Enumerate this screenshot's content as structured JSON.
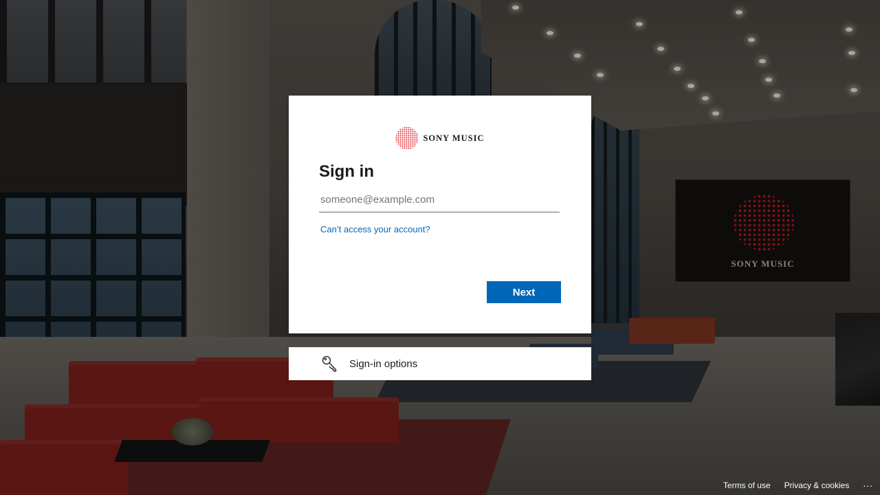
{
  "brand": {
    "logo_text": "SONY MUSIC",
    "logo_dot_color": "#e31b23",
    "tv_logo_text": "SONY MUSIC"
  },
  "signin": {
    "title": "Sign in",
    "email_placeholder": "someone@example.com",
    "email_value": "",
    "cant_access_link": "Can’t access your account?",
    "next_label": "Next"
  },
  "options": {
    "label": "Sign-in options",
    "icon": "key-icon"
  },
  "footer": {
    "terms": "Terms of use",
    "privacy": "Privacy & cookies",
    "more": "..."
  },
  "colors": {
    "accent": "#0067b8",
    "text": "#1b1b1b",
    "card_bg": "#ffffff"
  }
}
